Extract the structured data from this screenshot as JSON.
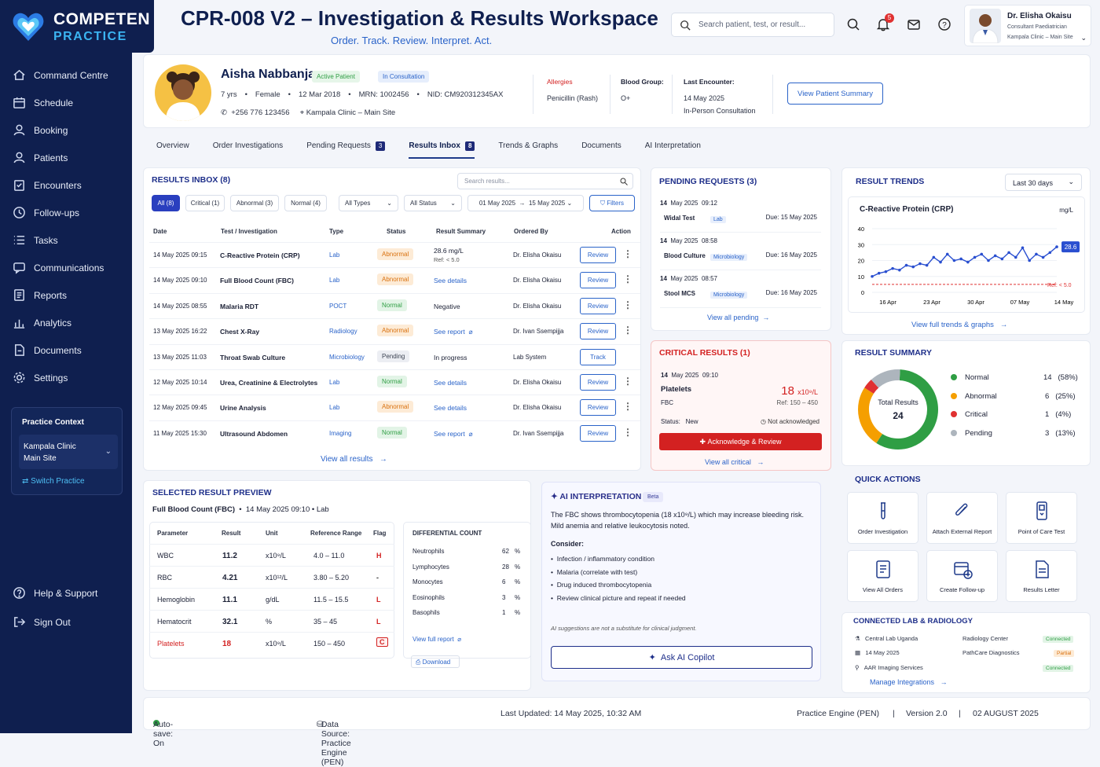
{
  "brand": {
    "line1": "COMPETEN",
    "line2": "PRACTICE"
  },
  "nav": [
    {
      "label": "Command Centre",
      "icon": "home-icon"
    },
    {
      "label": "Schedule",
      "icon": "calendar-icon"
    },
    {
      "label": "Booking",
      "icon": "person-icon"
    },
    {
      "label": "Patients",
      "icon": "patients-icon"
    },
    {
      "label": "Encounters",
      "icon": "clipboard-icon"
    },
    {
      "label": "Follow-ups",
      "icon": "followup-icon"
    },
    {
      "label": "Tasks",
      "icon": "tasks-icon"
    },
    {
      "label": "Communications",
      "icon": "chat-icon"
    },
    {
      "label": "Reports",
      "icon": "report-icon"
    },
    {
      "label": "Analytics",
      "icon": "analytics-icon"
    },
    {
      "label": "Documents",
      "icon": "document-icon"
    },
    {
      "label": "Settings",
      "icon": "gear-icon"
    }
  ],
  "practice_context": {
    "title": "Practice Context",
    "clinic": "Kampala Clinic",
    "site": "Main Site",
    "switch": "Switch Practice"
  },
  "bottom_nav": [
    {
      "label": "Help & Support",
      "icon": "help-icon"
    },
    {
      "label": "Sign Out",
      "icon": "signout-icon"
    }
  ],
  "header": {
    "title": "CPR-008 V2 – Investigation & Results Workspace",
    "subtitle": "Order. Track. Review. Interpret. Act.",
    "search_placeholder": "Search patient, test, or result...",
    "notif_count": "5"
  },
  "user": {
    "name": "Dr. Elisha Okaisu",
    "role": "Consultant Paediatrician",
    "location": "Kampala Clinic – Main Site"
  },
  "patient": {
    "name": "Aisha Nabbanja",
    "status": "Active Patient",
    "state": "In Consultation",
    "age": "7 yrs",
    "sex": "Female",
    "dob": "12 Mar 2018",
    "mrn": "MRN: 1002456",
    "nid": "NID: CM920312345AX",
    "phone": "+256 776 123456",
    "location": "Kampala Clinic – Main Site",
    "allergies_label": "Allergies",
    "allergies": "Penicillin (Rash)",
    "blood_label": "Blood Group:",
    "blood": "O+",
    "encounter_label": "Last Encounter:",
    "encounter_date": "14 May 2025",
    "encounter_type": "In-Person Consultation",
    "summary_btn": "View Patient Summary"
  },
  "tabs": [
    {
      "label": "Overview"
    },
    {
      "label": "Order Investigations"
    },
    {
      "label": "Pending Requests",
      "count": "3"
    },
    {
      "label": "Results Inbox",
      "count": "8"
    },
    {
      "label": "Trends & Graphs"
    },
    {
      "label": "Documents"
    },
    {
      "label": "AI Interpretation"
    }
  ],
  "inbox": {
    "title": "RESULTS INBOX (8)",
    "search_placeholder": "Search results...",
    "filters": [
      "All (8)",
      "Critical (1)",
      "Abnormal (3)",
      "Normal (4)"
    ],
    "types": "All Types",
    "status": "All Status",
    "date_from": "01 May 2025",
    "date_to": "15 May 2025",
    "filters_btn": "Filters",
    "headers": [
      "Date",
      "Test / Investigation",
      "Type",
      "Status",
      "Result Summary",
      "Ordered By",
      "Action"
    ],
    "rows": [
      {
        "date": "14 May 2025 09:15",
        "test": "C-Reactive Protein (CRP)",
        "type": "Lab",
        "status": "Abnormal",
        "summary": "28.6 mg/L",
        "summary2": "Ref: < 5.0",
        "by": "Dr. Elisha Okaisu",
        "action": "Review"
      },
      {
        "date": "14 May 2025 09:10",
        "test": "Full Blood Count (FBC)",
        "type": "Lab",
        "status": "Abnormal",
        "summary": "See details",
        "by": "Dr. Elisha Okaisu",
        "action": "Review"
      },
      {
        "date": "14 May 2025 08:55",
        "test": "Malaria RDT",
        "type": "POCT",
        "status": "Normal",
        "summary": "Negative",
        "by": "Dr. Elisha Okaisu",
        "action": "Review"
      },
      {
        "date": "13 May 2025 16:22",
        "test": "Chest X-Ray",
        "type": "Radiology",
        "status": "Abnormal",
        "summary": "See report",
        "by": "Dr. Ivan Ssempijja",
        "action": "Review"
      },
      {
        "date": "13 May 2025 11:03",
        "test": "Throat Swab Culture",
        "type": "Microbiology",
        "status": "Pending",
        "summary": "In progress",
        "by": "Lab System",
        "action": "Track"
      },
      {
        "date": "12 May 2025 10:14",
        "test": "Urea, Creatinine & Electrolytes",
        "type": "Lab",
        "status": "Normal",
        "summary": "See details",
        "by": "Dr. Elisha Okaisu",
        "action": "Review"
      },
      {
        "date": "12 May 2025 09:45",
        "test": "Urine Analysis",
        "type": "Lab",
        "status": "Abnormal",
        "summary": "See details",
        "by": "Dr. Elisha Okaisu",
        "action": "Review"
      },
      {
        "date": "11 May 2025 15:30",
        "test": "Ultrasound Abdomen",
        "type": "Imaging",
        "status": "Normal",
        "summary": "See report",
        "by": "Dr. Ivan Ssempijja",
        "action": "Review"
      }
    ],
    "view_all": "View all results"
  },
  "pending": {
    "title": "PENDING REQUESTS (3)",
    "items": [
      {
        "day": "14",
        "date": "May 2025",
        "time": "09:12",
        "test": "Widal Test",
        "tag": "Lab",
        "due": "Due: 15 May 2025"
      },
      {
        "day": "14",
        "date": "May 2025",
        "time": "08:58",
        "test": "Blood Culture",
        "tag": "Microbiology",
        "due": "Due: 16 May 2025"
      },
      {
        "day": "14",
        "date": "May 2025",
        "time": "08:57",
        "test": "Stool MCS",
        "tag": "Microbiology",
        "due": "Due: 16 May 2025"
      }
    ],
    "view_all": "View all pending"
  },
  "critical": {
    "title": "CRITICAL RESULTS (1)",
    "day": "14",
    "date": "May 2025",
    "time": "09:10",
    "test": "Platelets",
    "source": "FBC",
    "value": "18",
    "unit": "x10⁹/L",
    "ref": "Ref: 150 – 450",
    "status_label": "Status:",
    "status": "New",
    "ack_state": "Not acknowledged",
    "ack_btn": "Acknowledge & Review",
    "view_all": "View all critical"
  },
  "trends": {
    "title": "RESULT TRENDS",
    "range": "Last 30 days",
    "test": "C-Reactive Protein (CRP)",
    "unit": "mg/L",
    "current": "28.6",
    "ref_label": "Ref: < 5.0",
    "view_all": "View full trends & graphs"
  },
  "chart_data": {
    "type": "line",
    "title": "C-Reactive Protein (CRP)",
    "ylabel": "mg/L",
    "ylim": [
      0,
      40
    ],
    "yticks": [
      0,
      10,
      20,
      30,
      40
    ],
    "xticks": [
      "16 Apr",
      "23 Apr",
      "30 Apr",
      "07 May",
      "14 May"
    ],
    "ref_line": 5,
    "series": [
      {
        "values": [
          10,
          12,
          13,
          15,
          14,
          17,
          16,
          18,
          17,
          22,
          19,
          24,
          20,
          21,
          19,
          22,
          24,
          20,
          23,
          21,
          25,
          22,
          28,
          20,
          24,
          22,
          25,
          28.6
        ]
      }
    ]
  },
  "summary": {
    "title": "RESULT SUMMARY",
    "center_label": "Total Results",
    "total": "24",
    "items": [
      {
        "label": "Normal",
        "value": "14",
        "pct": "(58%)",
        "color": "#2f9e44"
      },
      {
        "label": "Abnormal",
        "value": "6",
        "pct": "(25%)",
        "color": "#f59f00"
      },
      {
        "label": "Critical",
        "value": "1",
        "pct": "(4%)",
        "color": "#e03131"
      },
      {
        "label": "Pending",
        "value": "3",
        "pct": "(13%)",
        "color": "#adb5bd"
      }
    ]
  },
  "quick": {
    "title": "QUICK ACTIONS",
    "items": [
      {
        "label": "Order Investigation",
        "icon": "test-tube-icon"
      },
      {
        "label": "Attach External Report",
        "icon": "paperclip-icon"
      },
      {
        "label": "Point of Care Test",
        "icon": "device-icon"
      },
      {
        "label": "View All Orders",
        "icon": "orders-icon"
      },
      {
        "label": "Create Follow-up",
        "icon": "calendar-plus-icon"
      },
      {
        "label": "Results Letter",
        "icon": "letter-icon"
      }
    ]
  },
  "labs": {
    "title": "CONNECTED LAB & RADIOLOGY",
    "left": [
      "Central Lab Uganda",
      "14 May 2025",
      "AAR Imaging Services"
    ],
    "right": [
      {
        "name": "Radiology Center",
        "state": "Connected"
      },
      {
        "name": "PathCare Diagnostics",
        "state": "Partial"
      },
      {
        "name": "",
        "state": "Connected"
      }
    ],
    "manage": "Manage Integrations"
  },
  "preview": {
    "title": "SELECTED RESULT PREVIEW",
    "test": "Full Blood Count (FBC)",
    "meta": "14 May 2025 09:10  •  Lab",
    "headers": [
      "Parameter",
      "Result",
      "Unit",
      "Reference Range",
      "Flag"
    ],
    "rows": [
      {
        "p": "WBC",
        "r": "11.2",
        "u": "x10⁹/L",
        "ref": "4.0 – 11.0",
        "f": "H"
      },
      {
        "p": "RBC",
        "r": "4.21",
        "u": "x10¹²/L",
        "ref": "3.80 – 5.20",
        "f": "-"
      },
      {
        "p": "Hemoglobin",
        "r": "11.1",
        "u": "g/dL",
        "ref": "11.5 – 15.5",
        "f": "L"
      },
      {
        "p": "Hematocrit",
        "r": "32.1",
        "u": "%",
        "ref": "35 – 45",
        "f": "L"
      },
      {
        "p": "Platelets",
        "r": "18",
        "u": "x10⁹/L",
        "ref": "150 – 450",
        "f": "C"
      }
    ],
    "diff_title": "DIFFERENTIAL COUNT",
    "diff": [
      {
        "n": "Neutrophils",
        "v": "62",
        "u": "%"
      },
      {
        "n": "Lymphocytes",
        "v": "28",
        "u": "%"
      },
      {
        "n": "Monocytes",
        "v": "6",
        "u": "%"
      },
      {
        "n": "Eosinophils",
        "v": "3",
        "u": "%"
      },
      {
        "n": "Basophils",
        "v": "1",
        "u": "%"
      }
    ],
    "full_report": "View full report",
    "download": "Download"
  },
  "ai": {
    "title": "AI INTERPRETATION",
    "beta": "Beta",
    "text": "The FBC shows thrombocytopenia (18 x10⁹/L) which may increase bleeding risk. Mild anemia and relative leukocytosis noted.",
    "consider": "Consider:",
    "points": [
      "Infection / inflammatory condition",
      "Malaria (correlate with test)",
      "Drug induced thrombocytopenia",
      "Review clinical picture and repeat if needed"
    ],
    "disclaimer": "AI suggestions are not a substitute for clinical judgment.",
    "ask": "Ask AI Copilot"
  },
  "footer": {
    "autosave": "Auto-save: On",
    "source": "Data Source: Practice Engine (PEN)",
    "updated": "Last Updated: 14 May 2025, 10:32 AM",
    "engine": "Practice Engine (PEN)",
    "version": "Version 2.0",
    "date": "02 AUGUST 2025"
  }
}
